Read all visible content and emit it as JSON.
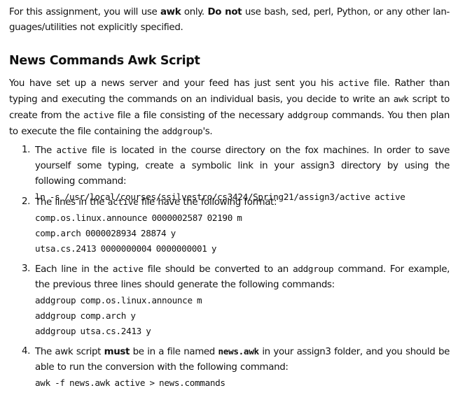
{
  "intro": {
    "part1": "For this assignment, you will use ",
    "bold1": "awk",
    "part2": " only.  ",
    "bold2": "Do not",
    "part3": " use bash, sed, perl, Python, or any other lan-guages/utilities not explicitly specified."
  },
  "section": {
    "title": "News Commands Awk Script",
    "paragraph": {
      "t1": "You have set up a news server and your feed has just sent you his ",
      "c1": "active",
      "t2": " file. Rather than typing and executing the commands on an individual basis, you decide to write an ",
      "c2": "awk",
      "t3": " script to create from the ",
      "c3": "active",
      "t4": " file a file consisting of the necessary ",
      "c4": "addgroup",
      "t5": " commands.  You then plan to execute the file containing the ",
      "c5": "addgroup",
      "t6": "'s."
    }
  },
  "items": [
    {
      "number": "1.",
      "t1": "The ",
      "c1": "active",
      "t2": " file is located in the course directory on the fox machines. In order to save yourself some typing, create a symbolic link in your assign3 directory by using the following command:",
      "code": [
        "ln -s /usr/local/courses/ssilvestro/cs3424/Spring21/assign3/active active"
      ]
    },
    {
      "number": "2.",
      "t1": "The lines in the ",
      "c1": "active",
      "t2": " file have the following format:",
      "code": [
        "comp.os.linux.announce 0000002587 02190 m",
        "comp.arch 0000028934 28874 y",
        "utsa.cs.2413 0000000004 0000000001 y"
      ]
    },
    {
      "number": "3.",
      "t1": "Each line in the ",
      "c1": "active",
      "t2": " file should be converted to an ",
      "c2": "addgroup",
      "t3": " command.  For example, the previous three lines should generate the following commands:",
      "code": [
        "addgroup comp.os.linux.announce m",
        "addgroup comp.arch y",
        "addgroup utsa.cs.2413 y"
      ]
    },
    {
      "number": "4.",
      "t1": "The awk script ",
      "b1": "must",
      "t2": " be in a file named ",
      "cb1": "news.awk",
      "t3": " in your assign3 folder, and you should be able to run the conversion with the following command:",
      "code": [
        "awk -f news.awk active > news.commands"
      ]
    }
  ]
}
